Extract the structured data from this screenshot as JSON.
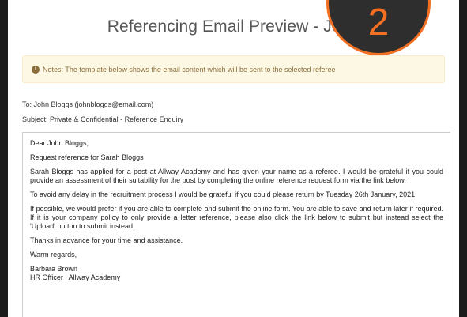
{
  "modal": {
    "title": "Referencing Email Preview - John",
    "step_number": "2"
  },
  "notice": {
    "icon": "info-circle-icon",
    "text": "Notes: The template below shows the email content which will be sent to the selected referee"
  },
  "email": {
    "to": "To: John Bloggs (johnbloggs@email.com)",
    "subject": "Subject: Private & Confidential - Reference Enquiry",
    "greeting": "Dear John Bloggs,",
    "heading": "Request reference for Sarah Bloggs",
    "paragraphs": [
      "Sarah Bloggs has applied for a post at Allway Academy and has given your name as a referee. I would be grateful if you could provide an assessment of their suitability for the post by completing the online reference request form via the link below.",
      "To avoid any delay in the recruitment process I would be grateful if you could please return by Tuesday 26th January, 2021.",
      "If possible, we would prefer if you are able to complete and submit the online form. You are able to save and return later if required. If it is your company policy to only provide a letter reference, please also click the link below to submit but instead select the 'Upload' button to submit instead.",
      "Thanks in advance for your time and assistance."
    ],
    "closing": "Warm regards,",
    "signature_name": "Barbara Brown",
    "signature_title": "HR Officer | Allway Academy"
  },
  "colors": {
    "accent": "#f36f21",
    "notice_bg": "#fcf8e3",
    "notice_text": "#8a6d3b"
  }
}
